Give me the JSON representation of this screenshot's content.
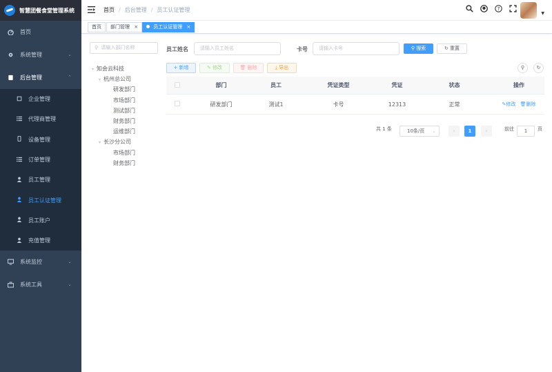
{
  "app": {
    "title": "智慧团餐食堂管理系统"
  },
  "sidebar": {
    "items": [
      {
        "label": "首页",
        "icon": "dashboard-icon"
      },
      {
        "label": "系统管理",
        "icon": "gear-icon"
      },
      {
        "label": "后台管理",
        "icon": "clipboard-icon"
      },
      {
        "label": "系统监控",
        "icon": "monitor-icon"
      },
      {
        "label": "系统工具",
        "icon": "toolbox-icon"
      }
    ],
    "sub_items": [
      {
        "label": "企业管理",
        "icon": "building-icon"
      },
      {
        "label": "代理商管理",
        "icon": "list-icon"
      },
      {
        "label": "设备管理",
        "icon": "phone-icon"
      },
      {
        "label": "订单管理",
        "icon": "list-icon"
      },
      {
        "label": "员工管理",
        "icon": "user-icon"
      },
      {
        "label": "员工认证管理",
        "icon": "user-icon"
      },
      {
        "label": "员工账户",
        "icon": "user-icon"
      },
      {
        "label": "充值管理",
        "icon": "user-icon"
      }
    ]
  },
  "breadcrumb": [
    "首页",
    "后台管理",
    "员工认证管理"
  ],
  "tags": [
    {
      "label": "首页"
    },
    {
      "label": "部门管理",
      "close": "×"
    },
    {
      "label": "员工认证管理",
      "close": "×"
    }
  ],
  "tree": {
    "search_placeholder": "请输入部门名称",
    "nodes": [
      {
        "label": "知会云科技",
        "level": 0,
        "caret": "▾"
      },
      {
        "label": "杭州总公司",
        "level": 1,
        "caret": "▾"
      },
      {
        "label": "研发部门",
        "level": 2
      },
      {
        "label": "市场部门",
        "level": 2
      },
      {
        "label": "测试部门",
        "level": 2
      },
      {
        "label": "财务部门",
        "level": 2
      },
      {
        "label": "运维部门",
        "level": 2
      },
      {
        "label": "长沙分公司",
        "level": 1,
        "caret": "▾"
      },
      {
        "label": "市场部门",
        "level": 2
      },
      {
        "label": "财务部门",
        "level": 2
      }
    ]
  },
  "filters": {
    "name_label": "员工姓名",
    "name_placeholder": "请输入员工姓名",
    "card_label": "卡号",
    "card_placeholder": "请输入卡号",
    "search_btn": "搜索",
    "reset_btn": "重置"
  },
  "toolbar": {
    "add": "新增",
    "edit": "修改",
    "delete": "删除",
    "export": "导出"
  },
  "table": {
    "columns": [
      "部门",
      "员工",
      "凭证类型",
      "凭证",
      "状态",
      "操作"
    ],
    "rows": [
      {
        "dept": "研发部门",
        "employee": "测试1",
        "cred_type": "卡号",
        "cred": "12313",
        "status": "正常",
        "edit": "修改",
        "delete": "删除"
      }
    ]
  },
  "pagination": {
    "total": "共 1 条",
    "size": "10条/页",
    "page": "1",
    "goto_label": "前往",
    "goto_value": "1",
    "page_unit": "页"
  }
}
